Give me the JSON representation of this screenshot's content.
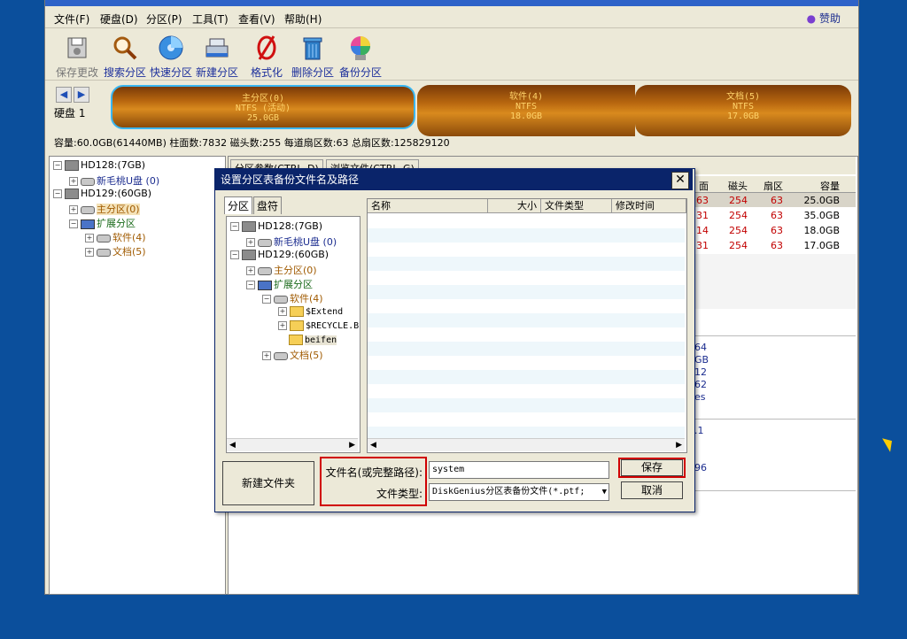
{
  "menu": {
    "items": [
      "文件(F)",
      "硬盘(D)",
      "分区(P)",
      "工具(T)",
      "查看(V)",
      "帮助(H)"
    ],
    "sponsor": "赞助"
  },
  "toolbar": {
    "buttons": [
      {
        "label": "保存更改",
        "icon": "save-icon"
      },
      {
        "label": "搜索分区",
        "icon": "magnifier-icon"
      },
      {
        "label": "快速分区",
        "icon": "quick-partition-icon"
      },
      {
        "label": "新建分区",
        "icon": "new-partition-icon"
      },
      {
        "label": "格式化",
        "icon": "format-icon"
      },
      {
        "label": "删除分区",
        "icon": "trash-icon"
      },
      {
        "label": "备份分区",
        "icon": "backup-icon"
      }
    ]
  },
  "disk_bar": {
    "label": "硬盘 1",
    "segments": [
      {
        "name": "主分区(0)",
        "fs": "NTFS (活动)",
        "size": "25.0GB"
      },
      {
        "name": "软件(4)",
        "fs": "NTFS",
        "size": "18.0GB"
      },
      {
        "name": "文档(5)",
        "fs": "NTFS",
        "size": "17.0GB"
      }
    ],
    "info": "容量:60.0GB(61440MB)   柱面数:7832   磁头数:255   每道扇区数:63   总扇区数:125829120"
  },
  "left_tree": {
    "nodes": [
      "HD128:(7GB)",
      "新毛桃U盘 (0)",
      "HD129:(60GB)",
      "主分区(0)",
      "扩展分区",
      "软件(4)",
      "文档(5)"
    ]
  },
  "right_pane": {
    "tabs": [
      "分区参数(CTRL_D)",
      "浏览文件(CTRL_G)"
    ],
    "headers": [
      "面",
      "磁头",
      "扇区",
      "容量"
    ],
    "rows": [
      {
        "c1": "63",
        "c2": "254",
        "c3": "63",
        "size": "25.0GB"
      },
      {
        "c1": "31",
        "c2": "254",
        "c3": "63",
        "size": "35.0GB"
      },
      {
        "c1": "14",
        "c2": "254",
        "c3": "63",
        "size": "18.0GB"
      },
      {
        "c1": "31",
        "c2": "254",
        "c3": "63",
        "size": "17.0GB"
      }
    ],
    "fragments": [
      "64",
      "GB",
      "12",
      "62",
      "es",
      ".1",
      "96"
    ]
  },
  "dialog": {
    "title": "设置分区表备份文件名及路径",
    "tabs": [
      "分区",
      "盘符"
    ],
    "tree": [
      "HD128:(7GB)",
      "新毛桃U盘 (0)",
      "HD129:(60GB)",
      "主分区(0)",
      "扩展分区",
      "软件(4)",
      "$Extend",
      "$RECYCLE.BIN",
      "beifen",
      "文档(5)"
    ],
    "list_headers": [
      "名称",
      "大小",
      "文件类型",
      "修改时间"
    ],
    "new_folder_label": "新建文件夹",
    "filename_label": "文件名(或完整路径):",
    "filetype_label": "文件类型:",
    "filename_value": "system",
    "filetype_value": "DiskGenius分区表备份文件(*.ptf;",
    "save_label": "保存",
    "cancel_label": "取消"
  }
}
